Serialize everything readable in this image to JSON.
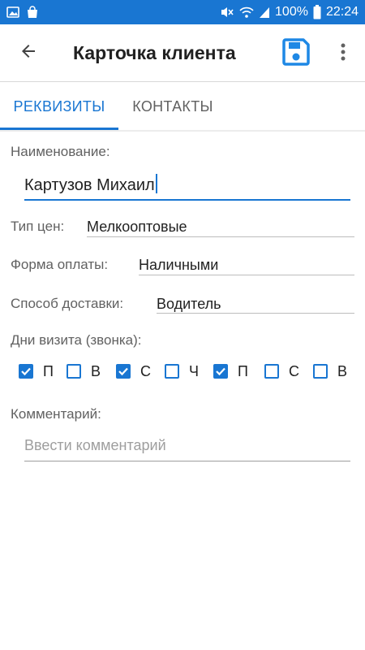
{
  "status_bar": {
    "battery": "100%",
    "time": "22:24",
    "icons": [
      "image-icon",
      "shopping-bag-icon",
      "mute-icon",
      "wifi-icon",
      "signal-icon",
      "battery-icon"
    ]
  },
  "app_bar": {
    "title": "Карточка клиента",
    "back_icon": "arrow-back-icon",
    "save_icon": "save-icon",
    "more_icon": "more-vert-icon"
  },
  "tabs": [
    {
      "label": "РЕКВИЗИТЫ",
      "active": true
    },
    {
      "label": "КОНТАКТЫ",
      "active": false
    }
  ],
  "form": {
    "name_label": "Наименование:",
    "name_value": "Картузов Михаил",
    "price_type_label": "Тип цен:",
    "price_type_value": "Мелкооптовые",
    "payment_label": "Форма оплаты:",
    "payment_value": "Наличными",
    "delivery_label": "Способ доставки:",
    "delivery_value": "Водитель",
    "visit_days_label": "Дни визита (звонка):",
    "visit_days": [
      {
        "label": "П",
        "checked": true
      },
      {
        "label": "В",
        "checked": false
      },
      {
        "label": "С",
        "checked": true
      },
      {
        "label": "Ч",
        "checked": false
      },
      {
        "label": "П",
        "checked": true
      },
      {
        "label": "С",
        "checked": false
      },
      {
        "label": "В",
        "checked": false
      }
    ],
    "comment_label": "Комментарий:",
    "comment_placeholder": "Ввести комментарий"
  },
  "colors": {
    "accent": "#1976d2",
    "status_bar": "#1976d2",
    "text": "#212121",
    "label": "#616161"
  }
}
